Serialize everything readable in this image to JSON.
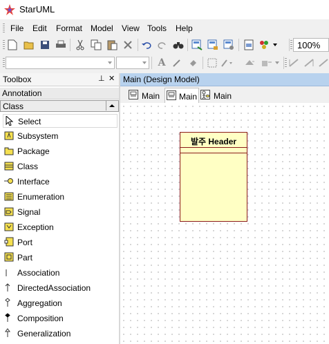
{
  "app": {
    "title": "StarUML"
  },
  "menu": [
    "File",
    "Edit",
    "Format",
    "Model",
    "View",
    "Tools",
    "Help"
  ],
  "toolbar": {
    "zoom": "100%"
  },
  "toolbox": {
    "title": "Toolbox",
    "pin_glyph": "⊥",
    "close_glyph": "✕",
    "sections": {
      "annotation": "Annotation",
      "class": "Class"
    },
    "tools": [
      {
        "label": "Select",
        "icon": "cursor-icon"
      },
      {
        "label": "Subsystem",
        "icon": "subsystem-icon"
      },
      {
        "label": "Package",
        "icon": "package-icon"
      },
      {
        "label": "Class",
        "icon": "class-icon"
      },
      {
        "label": "Interface",
        "icon": "interface-icon"
      },
      {
        "label": "Enumeration",
        "icon": "enumeration-icon"
      },
      {
        "label": "Signal",
        "icon": "signal-icon"
      },
      {
        "label": "Exception",
        "icon": "exception-icon"
      },
      {
        "label": "Port",
        "icon": "port-icon"
      },
      {
        "label": "Part",
        "icon": "part-icon"
      },
      {
        "label": "Association",
        "icon": "association-icon"
      },
      {
        "label": "DirectedAssociation",
        "icon": "directed-association-icon"
      },
      {
        "label": "Aggregation",
        "icon": "aggregation-icon"
      },
      {
        "label": "Composition",
        "icon": "composition-icon"
      },
      {
        "label": "Generalization",
        "icon": "generalization-icon"
      }
    ]
  },
  "diagram": {
    "header": "Main (Design Model)",
    "tabs": [
      "Main",
      "Main",
      "Main"
    ],
    "class_element": {
      "name": "발주 Header"
    }
  },
  "colors": {
    "class_fill": "#ffffc4",
    "class_border": "#8b1a1a",
    "diagram_header": "#b8d2ee"
  }
}
